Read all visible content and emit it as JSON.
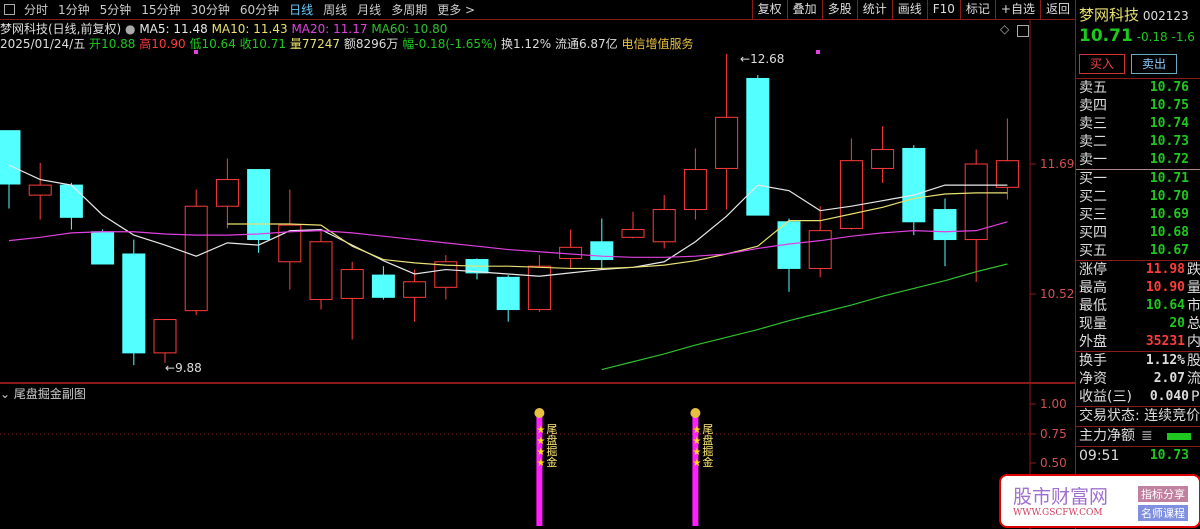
{
  "toolbar": {
    "periods": [
      "分时",
      "1分钟",
      "5分钟",
      "15分钟",
      "30分钟",
      "60分钟",
      "日线",
      "周线",
      "月线",
      "多周期",
      "更多 >"
    ],
    "active": "日线",
    "tools": [
      "复权",
      "叠加",
      "多股",
      "统计",
      "画线",
      "F10",
      "标记",
      "+自选",
      "返回"
    ]
  },
  "header": {
    "title": "梦网科技(日线,前复权)",
    "ma5": "MA5: 11.48",
    "ma10": "MA10: 11.43",
    "ma20": "MA20: 11.17",
    "ma60": "MA60: 10.80",
    "date": "2025/01/24/五",
    "open_l": "开",
    "open": "10.88",
    "high_l": "高",
    "high": "10.90",
    "low_l": "低",
    "low": "10.64",
    "close_l": "收",
    "close": "10.71",
    "vol_l": "量",
    "vol": "77247",
    "amt": "额8296万",
    "chg_l": "幅",
    "chg": "-0.18(-1.65%)",
    "turnover": "换1.12%",
    "float": "流通6.87亿",
    "industry": "电信增值服务"
  },
  "colors": {
    "up": "#ff3b3b",
    "down": "#54ffff",
    "ma5": "#e8e8e8",
    "ma10": "#e8e070",
    "ma20": "#e040e0",
    "ma60": "#30c030"
  },
  "chart_data": {
    "type": "candlestick",
    "price_ticks": [
      "11.69",
      "10.52"
    ],
    "max_label": "12.68",
    "min_label": "9.88",
    "ohlc": [
      [
        11.99,
        11.99,
        11.29,
        11.51
      ],
      [
        11.41,
        11.7,
        11.19,
        11.5
      ],
      [
        11.5,
        11.52,
        11.1,
        11.21
      ],
      [
        11.08,
        11.1,
        10.79,
        10.79
      ],
      [
        10.88,
        11.01,
        9.88,
        9.99
      ],
      [
        9.99,
        10.29,
        9.9,
        10.29
      ],
      [
        10.37,
        11.46,
        10.33,
        11.31
      ],
      [
        11.31,
        11.74,
        11.11,
        11.55
      ],
      [
        11.64,
        11.64,
        10.89,
        11.01
      ],
      [
        10.81,
        11.46,
        10.56,
        11.14
      ],
      [
        10.47,
        11.08,
        10.38,
        10.99
      ],
      [
        10.48,
        10.81,
        10.11,
        10.74
      ],
      [
        10.69,
        10.77,
        10.47,
        10.49
      ],
      [
        10.49,
        10.74,
        10.27,
        10.63
      ],
      [
        10.58,
        10.87,
        10.47,
        10.81
      ],
      [
        10.83,
        10.84,
        10.65,
        10.71
      ],
      [
        10.67,
        10.69,
        10.27,
        10.38
      ],
      [
        10.38,
        10.87,
        10.36,
        10.77
      ],
      [
        10.84,
        11.1,
        10.75,
        10.94
      ],
      [
        10.99,
        11.2,
        10.74,
        10.83
      ],
      [
        11.03,
        11.26,
        11.02,
        11.1
      ],
      [
        10.99,
        11.41,
        10.93,
        11.28
      ],
      [
        11.28,
        11.83,
        11.19,
        11.64
      ],
      [
        11.65,
        12.68,
        11.28,
        12.11
      ],
      [
        12.46,
        12.49,
        11.23,
        11.23
      ],
      [
        11.17,
        11.2,
        10.54,
        10.75
      ],
      [
        10.75,
        11.31,
        10.67,
        11.09
      ],
      [
        11.11,
        11.92,
        11.1,
        11.72
      ],
      [
        11.65,
        12.03,
        11.52,
        11.82
      ],
      [
        11.83,
        11.86,
        11.05,
        11.17
      ],
      [
        11.28,
        11.38,
        10.77,
        11.01
      ],
      [
        11.01,
        11.82,
        10.63,
        11.69
      ],
      [
        11.48,
        12.1,
        11.37,
        11.72
      ]
    ],
    "ma5": [
      11.68,
      11.55,
      11.5,
      11.23,
      11.05,
      10.96,
      10.86,
      10.98,
      10.96,
      11.09,
      11.1,
      10.96,
      10.82,
      10.7,
      10.74,
      10.72,
      10.7,
      10.68,
      10.71,
      10.74,
      10.76,
      10.81,
      10.99,
      11.22,
      11.5,
      11.45,
      11.27,
      11.31,
      11.36,
      11.41,
      11.5,
      11.5,
      11.5
    ],
    "ma10": [
      null,
      null,
      null,
      null,
      null,
      null,
      null,
      11.15,
      11.15,
      11.15,
      11.14,
      10.95,
      10.83,
      10.8,
      10.78,
      10.77,
      10.77,
      10.76,
      10.75,
      10.75,
      10.76,
      10.78,
      10.82,
      10.88,
      10.95,
      11.18,
      11.18,
      11.24,
      11.3,
      11.38,
      11.42,
      11.43,
      11.43
    ],
    "ma20": [
      11.0,
      11.03,
      11.07,
      11.08,
      11.08,
      11.06,
      11.05,
      11.05,
      11.06,
      11.08,
      11.09,
      11.07,
      11.04,
      11.01,
      10.98,
      10.95,
      10.92,
      10.9,
      10.88,
      10.86,
      10.85,
      10.85,
      10.86,
      10.88,
      10.93,
      10.97,
      11.0,
      11.04,
      11.07,
      11.09,
      11.08,
      11.09,
      11.17
    ],
    "ma60": [
      null,
      null,
      null,
      null,
      null,
      null,
      null,
      null,
      null,
      null,
      null,
      null,
      null,
      null,
      null,
      null,
      null,
      null,
      null,
      9.84,
      9.91,
      9.98,
      10.06,
      10.13,
      10.2,
      10.28,
      10.35,
      10.42,
      10.5,
      10.57,
      10.64,
      10.72,
      10.79
    ],
    "sub": {
      "title": "尾盘掘金副图",
      "ticks": [
        "1.00",
        "0.75",
        "0.50"
      ],
      "signal_indices": [
        17,
        22
      ],
      "signal_text": [
        "尾",
        "盘",
        "掘",
        "金"
      ]
    }
  },
  "quote": {
    "name": "梦网科技",
    "code": "002123",
    "price": "10.71",
    "chg": "-0.18",
    "pct": "-1.6",
    "buy": "买入",
    "sell": "卖出",
    "asks": [
      {
        "l": "卖五",
        "v": "10.76"
      },
      {
        "l": "卖四",
        "v": "10.75"
      },
      {
        "l": "卖三",
        "v": "10.74"
      },
      {
        "l": "卖二",
        "v": "10.73"
      },
      {
        "l": "卖一",
        "v": "10.72"
      }
    ],
    "bids": [
      {
        "l": "买一",
        "v": "10.71"
      },
      {
        "l": "买二",
        "v": "10.70"
      },
      {
        "l": "买三",
        "v": "10.69"
      },
      {
        "l": "买四",
        "v": "10.68"
      },
      {
        "l": "买五",
        "v": "10.67"
      }
    ],
    "stats": [
      {
        "l": "涨停",
        "v": "11.98",
        "e": "跌",
        "c": "r"
      },
      {
        "l": "最高",
        "v": "10.90",
        "e": "量",
        "c": "r"
      },
      {
        "l": "最低",
        "v": "10.64",
        "e": "市",
        "c": "g"
      },
      {
        "l": "现量",
        "v": "20",
        "e": "总",
        "c": "g"
      },
      {
        "l": "外盘",
        "v": "35231",
        "e": "内",
        "c": "r"
      }
    ],
    "fund": [
      {
        "l": "换手",
        "v": "1.12%",
        "e": "股"
      },
      {
        "l": "净资",
        "v": "2.07",
        "e": "流"
      },
      {
        "l": "收益(三)",
        "v": "0.040",
        "e": "P"
      }
    ],
    "status": "交易状态: 连续竞价",
    "net": "主力净额",
    "tick_time": "09:51",
    "tick_price": "10.73"
  },
  "watermark": {
    "name": "股市财富网",
    "url": "WWW.GSCFW.COM",
    "tag1": "指标分享",
    "tag2": "名师课程"
  }
}
